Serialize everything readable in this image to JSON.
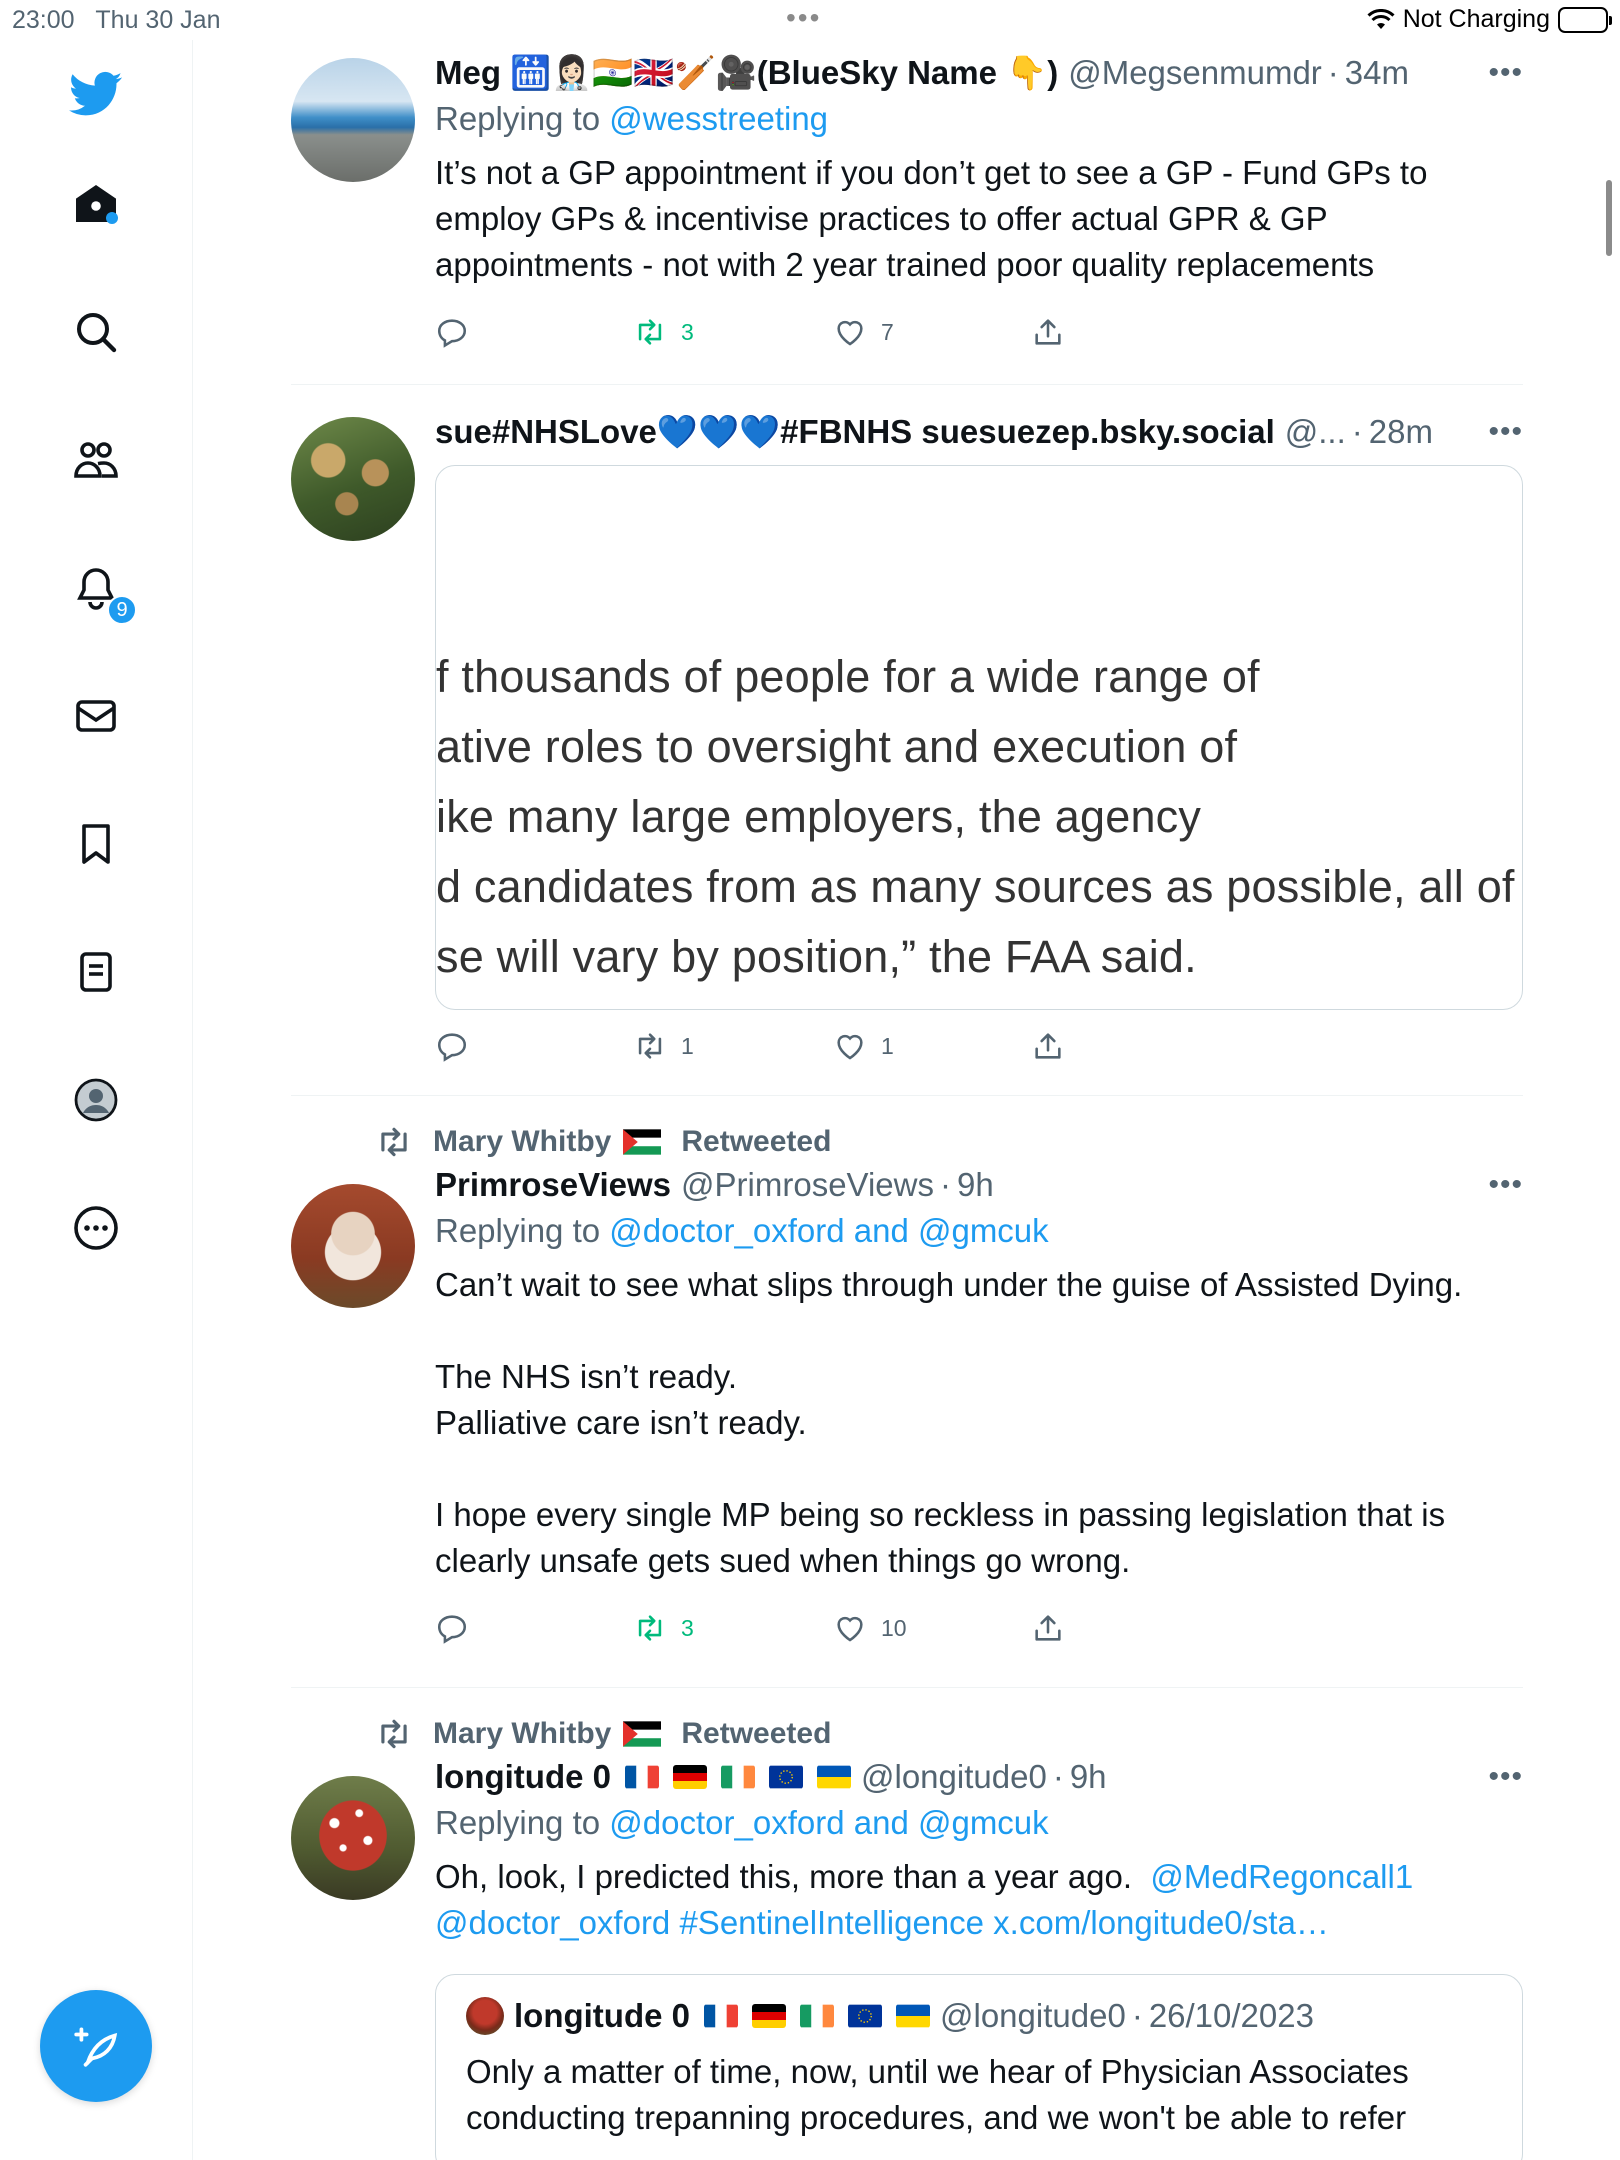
{
  "status_bar": {
    "time": "23:00",
    "date": "Thu 30 Jan",
    "charging": "Not Charging"
  },
  "sidebar": {
    "notifications_badge": "9"
  },
  "tweets": [
    {
      "name": "Meg 🛗👩🏻‍⚕️🇮🇳🇬🇧🏏🎥(BlueSky Name 👇)",
      "handle": "@Megsenmumdr",
      "time": "34m",
      "replying_prefix": "Replying to",
      "replying_to": "@wesstreeting",
      "text": "It’s not a GP appointment if you don’t get to see a GP - Fund GPs to employ GPs & incentivise practices to offer actual GPR & GP appointments - not with 2 year trained poor quality replacements",
      "replies": "",
      "retweets": "3",
      "likes": "7"
    },
    {
      "name": "sue#NHSLove💙💙💙#FBNHS suesuezep.bsky.social",
      "handle": "@...",
      "time": "28m",
      "media_lines": [
        "f thousands of people for a wide range of",
        "ative roles to oversight and execution of",
        "ike many large employers, the agency",
        "d candidates from as many sources as possible, all of",
        "se will vary by position,” the FAA said."
      ],
      "replies": "",
      "retweets": "1",
      "likes": "1"
    },
    {
      "retweeted_by": "Mary Whitby",
      "retweeted_label": "Retweeted",
      "name": "PrimroseViews",
      "handle": "@PrimroseViews",
      "time": "9h",
      "replying_prefix": "Replying to",
      "replying_to": "@doctor_oxford and @gmcuk",
      "text_lines": [
        "Can’t wait to see what slips through under the guise of Assisted Dying.",
        "",
        "The NHS isn’t ready.",
        "Palliative care isn’t ready.",
        "",
        "I hope every single MP being so reckless in passing legislation that is clearly unsafe gets sued when things go wrong."
      ],
      "replies": "",
      "retweets": "3",
      "likes": "10"
    },
    {
      "retweeted_by": "Mary Whitby",
      "retweeted_label": "Retweeted",
      "name": "longitude 0",
      "handle": "@longitude0",
      "time": "9h",
      "replying_prefix": "Replying to",
      "replying_to": "@doctor_oxford and @gmcuk",
      "text_plain": "Oh, look, I predicted this, more than a year ago.",
      "text_link1": "@MedRegoncall1",
      "text_link2": "@doctor_oxford #SentinelIntelligence x.com/longitude0/sta…",
      "quote": {
        "name": "longitude 0",
        "handle": "@longitude0",
        "date": "26/10/2023",
        "text": "Only a matter of time, now, until we hear of Physician Associates conducting trepanning procedures, and we won't be able to refer"
      }
    }
  ],
  "colors": {
    "accent": "#1d9bf0",
    "retweet_green": "#00ba7c",
    "secondary_text": "#536471"
  }
}
